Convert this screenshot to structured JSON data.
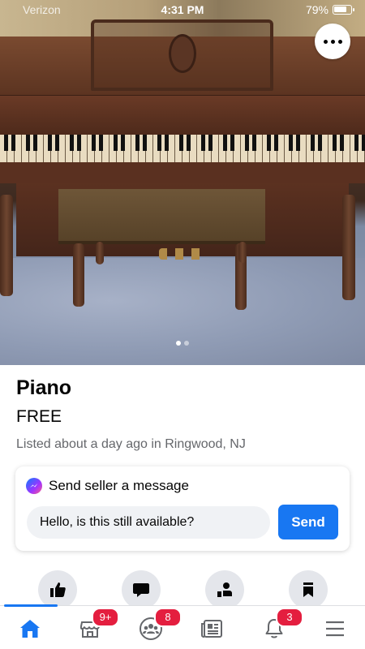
{
  "status_bar": {
    "carrier": "Verizon",
    "time": "4:31 PM",
    "battery": "79%"
  },
  "photo": {
    "image_count": 2,
    "active_index": 0
  },
  "listing": {
    "title": "Piano",
    "price": "FREE",
    "listed_text": "Listed about a day ago in Ringwood, NJ"
  },
  "message": {
    "heading": "Send seller a message",
    "input_value": "Hello, is this still available?",
    "send_label": "Send"
  },
  "actions": [
    {
      "icon": "thumbs-up-icon"
    },
    {
      "icon": "chat-bubble-icon"
    },
    {
      "icon": "share-icon"
    },
    {
      "icon": "bookmark-icon"
    }
  ],
  "tabbar": {
    "active": "home",
    "marketplace_badge": "9+",
    "groups_badge": "8",
    "notifications_badge": "3"
  },
  "colors": {
    "accent": "#1877f2",
    "badge": "#e41e3f",
    "secondary_text": "#65676b"
  }
}
